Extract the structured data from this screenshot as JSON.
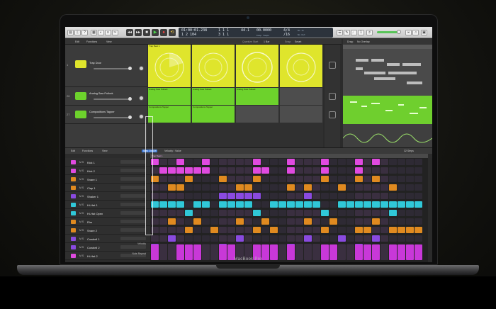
{
  "laptop": {
    "brand": "MacBook Pro"
  },
  "control_bar": {
    "position": "01:00:01.238",
    "position_sub": "1 2 104",
    "bars": "1 1 1",
    "bars_sub": "3 1 1",
    "tempo": "44.1",
    "tempo_label": "",
    "time": "00.0000",
    "time_label": "Keep Tempo",
    "signature": "4/4",
    "signature_sub": "/16",
    "in_label": "No In",
    "out_label": "No Out"
  },
  "tracks_header": {
    "edit": "Edit",
    "functions": "Functions",
    "view": "View",
    "quantize_label": "Quantize Start",
    "quantize_value": "1 Bar",
    "snap": "Snap:",
    "snap_value": "Smart"
  },
  "tracks": [
    {
      "num": "1",
      "name": "Trap Door",
      "color": "#dfe52c"
    },
    {
      "num": "26",
      "name": "Analog Saw Pollock",
      "color": "#6dd22c"
    },
    {
      "num": "27",
      "name": "Compositions Tapper",
      "color": "#6dd22c"
    }
  ],
  "cells": {
    "row1_titles": [
      "Trap Beat 1",
      "",
      "",
      ""
    ],
    "row2_titles": [
      "Analog Saw Pollock",
      "Analog Saw Pollock",
      "Analog Saw Pollock",
      ""
    ],
    "row3_titles": [
      "Compositions Tapper",
      "Compositions Tapper",
      "",
      ""
    ]
  },
  "editor_header": {
    "drag": "Drag:",
    "drag_value": "No Overlap"
  },
  "step_toolbar": {
    "edit": "Edit",
    "functions": "Functions",
    "view": "View",
    "tab_active": "Step On/Off",
    "tab_other": "Velocity / Value",
    "steps": "32 Steps",
    "region": "Trap Beat 1"
  },
  "drum_rows": [
    {
      "name": "Kick 1",
      "color": "#e04ae0"
    },
    {
      "name": "Kick 2",
      "color": "#e04ae0"
    },
    {
      "name": "Snare 1",
      "color": "#e08a20"
    },
    {
      "name": "Clap 1",
      "color": "#e08a20"
    },
    {
      "name": "Shaker 1",
      "color": "#8a4ae0"
    },
    {
      "name": "Hi-Hat 1",
      "color": "#30c8d8"
    },
    {
      "name": "Hi-Hat Open",
      "color": "#30c8d8"
    },
    {
      "name": "Rim",
      "color": "#e08a20"
    },
    {
      "name": "Snare 2",
      "color": "#e08a20"
    },
    {
      "name": "Cowbell 1",
      "color": "#8a4ae0"
    },
    {
      "name": "Cowbell 2",
      "color": "#8a4ae0"
    },
    {
      "name": "Hi-Hat 2",
      "color": "#e04ae0"
    }
  ],
  "footer_rows": {
    "velocity": "Velocity",
    "note_repeat": "Note Repeat"
  },
  "colors": {
    "magenta": "#e04ae0",
    "orange": "#e08a20",
    "violet": "#8a4ae0",
    "cyan": "#30c8d8",
    "yellow": "#dfe52c",
    "green": "#6dd22c",
    "pink_velocity": "#c838d8"
  }
}
